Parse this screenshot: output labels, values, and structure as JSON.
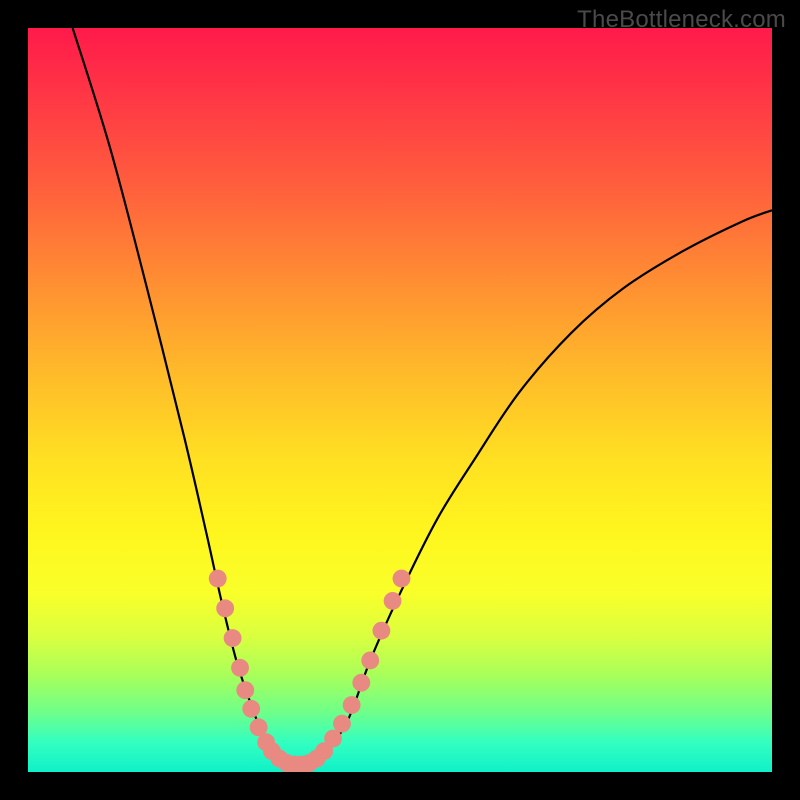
{
  "watermark": "TheBottleneck.com",
  "chart_data": {
    "type": "line",
    "title": "",
    "xlabel": "",
    "ylabel": "",
    "xlim": [
      0,
      100
    ],
    "ylim": [
      0,
      100
    ],
    "grid": false,
    "legend": false,
    "series": [
      {
        "name": "bottleneck-curve",
        "color": "#000000",
        "points": [
          {
            "x": 6,
            "y": 100
          },
          {
            "x": 11,
            "y": 84
          },
          {
            "x": 16,
            "y": 65
          },
          {
            "x": 21,
            "y": 45
          },
          {
            "x": 24,
            "y": 32
          },
          {
            "x": 26,
            "y": 23
          },
          {
            "x": 28,
            "y": 15
          },
          {
            "x": 30,
            "y": 9
          },
          {
            "x": 32,
            "y": 4
          },
          {
            "x": 34,
            "y": 1.5
          },
          {
            "x": 35,
            "y": 1
          },
          {
            "x": 37,
            "y": 1
          },
          {
            "x": 38,
            "y": 1.2
          },
          {
            "x": 40,
            "y": 2.5
          },
          {
            "x": 43,
            "y": 7
          },
          {
            "x": 46,
            "y": 15
          },
          {
            "x": 50,
            "y": 24
          },
          {
            "x": 55,
            "y": 34
          },
          {
            "x": 60,
            "y": 42
          },
          {
            "x": 66,
            "y": 51
          },
          {
            "x": 73,
            "y": 59
          },
          {
            "x": 80,
            "y": 65
          },
          {
            "x": 88,
            "y": 70
          },
          {
            "x": 96,
            "y": 74
          },
          {
            "x": 100,
            "y": 75.5
          }
        ]
      }
    ],
    "markers": {
      "name": "highlight-dots",
      "color": "#e88a82",
      "radius": 1.2,
      "points": [
        {
          "x": 25.5,
          "y": 26
        },
        {
          "x": 26.5,
          "y": 22
        },
        {
          "x": 27.5,
          "y": 18
        },
        {
          "x": 28.5,
          "y": 14
        },
        {
          "x": 29.2,
          "y": 11
        },
        {
          "x": 30.0,
          "y": 8.5
        },
        {
          "x": 31.0,
          "y": 6
        },
        {
          "x": 32.0,
          "y": 4
        },
        {
          "x": 32.8,
          "y": 2.8
        },
        {
          "x": 33.8,
          "y": 1.8
        },
        {
          "x": 34.8,
          "y": 1.2
        },
        {
          "x": 35.8,
          "y": 1.0
        },
        {
          "x": 36.8,
          "y": 1.0
        },
        {
          "x": 37.8,
          "y": 1.2
        },
        {
          "x": 38.8,
          "y": 1.8
        },
        {
          "x": 39.8,
          "y": 2.8
        },
        {
          "x": 41.0,
          "y": 4.5
        },
        {
          "x": 42.2,
          "y": 6.5
        },
        {
          "x": 43.5,
          "y": 9
        },
        {
          "x": 44.8,
          "y": 12
        },
        {
          "x": 46.0,
          "y": 15
        },
        {
          "x": 47.5,
          "y": 19
        },
        {
          "x": 49.0,
          "y": 23
        },
        {
          "x": 50.2,
          "y": 26
        }
      ]
    }
  }
}
